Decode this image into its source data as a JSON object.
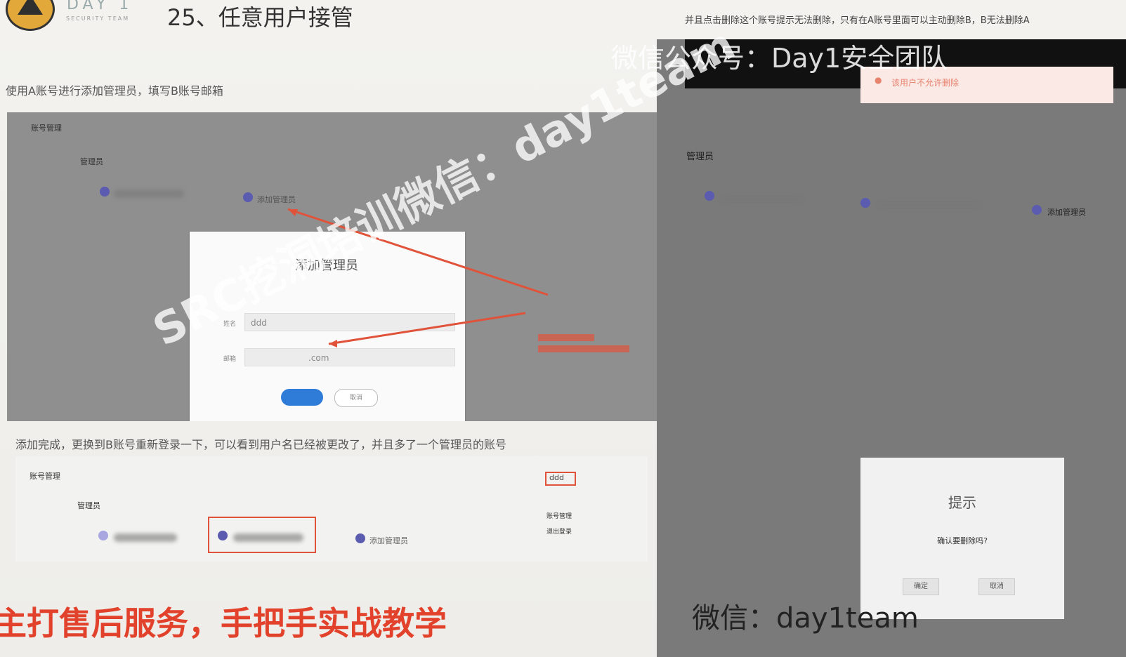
{
  "logo": {
    "text": "DAY 1",
    "sub": "SECURITY TEAM"
  },
  "slide": {
    "title": "25、任意用户接管",
    "caption1": "使用A账号进行添加管理员，填写B账号邮箱",
    "caption2": "添加完成，更换到B账号重新登录一下，可以看到用户名已经被更改了，并且多了一个管理员的账号"
  },
  "shot1": {
    "section": "账号管理",
    "group": "管理员",
    "add_admin": "添加管理员",
    "dialog": {
      "title": "添加管理员",
      "name_label": "姓名",
      "name_value": "ddd",
      "email_label": "邮箱",
      "email_value": ".com",
      "cancel": "取消"
    }
  },
  "shot2": {
    "section": "账号管理",
    "group": "管理员",
    "add_admin": "添加管理员",
    "username": "ddd",
    "menu": [
      "账号管理",
      "退出登录"
    ]
  },
  "right": {
    "note": "并且点击删除这个账号提示无法删除，只有在A账号里面可以主动删除B，B无法删除A",
    "toast": "该用户不允许删除",
    "group": "管理员",
    "add_admin": "添加管理员",
    "confirm": {
      "title": "提示",
      "message": "确认要删除吗?",
      "ok": "确定",
      "cancel": "取消"
    }
  },
  "watermarks": {
    "diagonal": "SRC挖洞培训微信：day1team",
    "top": "微信公众号：Day1安全团队",
    "bottom": "微信：day1team"
  },
  "promo": "主打售后服务，手把手实战教学",
  "colors": {
    "accent_red": "#e0533a",
    "promo_red": "#e2422b",
    "primary_blue": "#2f7bd8"
  }
}
